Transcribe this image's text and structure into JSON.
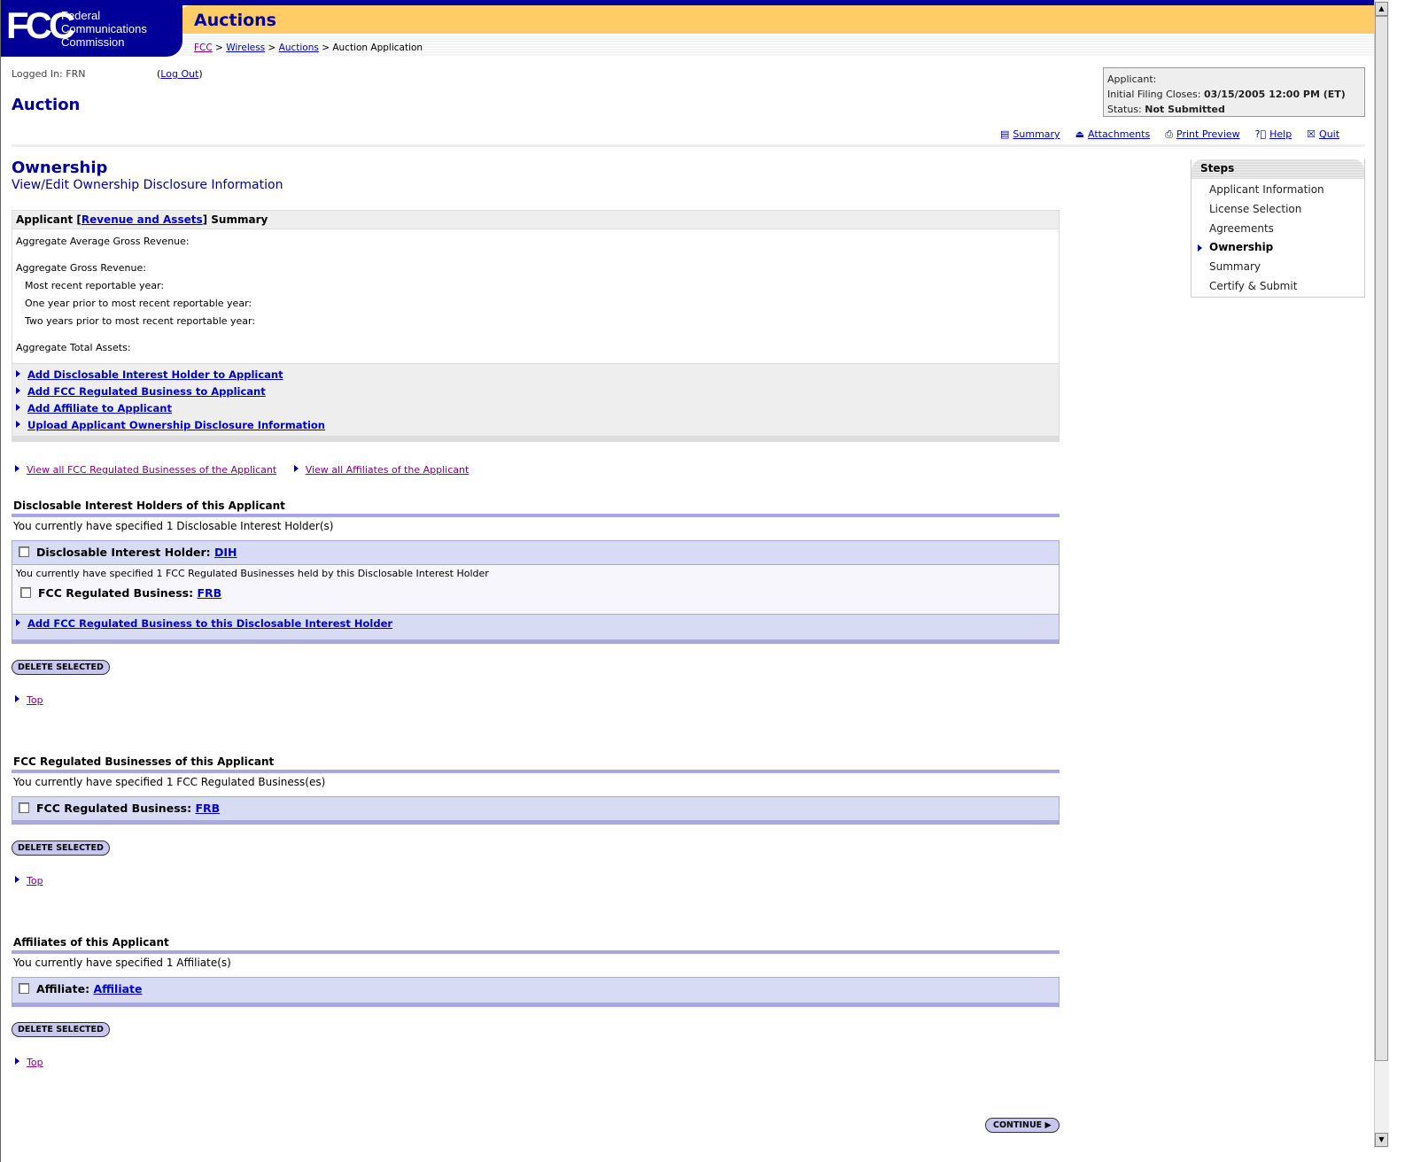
{
  "header": {
    "logo_mark": "FCC",
    "logo_text": [
      "Federal",
      "Communications",
      "Commission"
    ],
    "app_title": "Auctions",
    "breadcrumb": [
      {
        "label": "FCC"
      },
      {
        "label": "Wireless"
      },
      {
        "label": "Auctions"
      }
    ],
    "breadcrumb_current": "Auction Application",
    "separator": ">"
  },
  "session": {
    "logged_in": "Logged In: FRN",
    "logout_label": "Log Out"
  },
  "page_title": "Auction",
  "info": {
    "applicant_label": "Applicant:",
    "filing_label": "Initial Filing Closes:",
    "filing_value": "03/15/2005 12:00 PM (ET)",
    "status_label": "Status:",
    "status_value": "Not Submitted"
  },
  "toolbar": [
    {
      "label": "Summary",
      "icon": "summary-icon"
    },
    {
      "label": "Attachments",
      "icon": "upload-icon"
    },
    {
      "label": "Print Preview",
      "icon": "print-icon"
    },
    {
      "label": "Help",
      "icon": "help-icon"
    },
    {
      "label": "Quit",
      "icon": "close-icon"
    }
  ],
  "section": {
    "title": "Ownership",
    "subtitle": "View/Edit Ownership Disclosure Information"
  },
  "summary": {
    "hd_pre": "Applicant [",
    "hd_link": "Revenue and Assets",
    "hd_post": "] Summary",
    "lines": [
      "Aggregate Average Gross Revenue:",
      "Aggregate Gross Revenue:",
      "Most recent reportable year:",
      "One year prior to most recent reportable year:",
      "Two years prior to most recent reportable year:",
      "Aggregate Total Assets:"
    ],
    "links": [
      "Add Disclosable Interest Holder to Applicant",
      "Add FCC Regulated Business to Applicant",
      "Add Affiliate to Applicant",
      "Upload Applicant Ownership Disclosure Information"
    ]
  },
  "view_links": [
    "View all FCC Regulated Businesses of the Applicant",
    "View all Affiliates of the Applicant"
  ],
  "dih": {
    "title": "Disclosable Interest Holders of this Applicant",
    "count_text": "You currently have specified 1 Disclosable Interest Holder(s)",
    "row_label": "Disclosable Interest Holder:",
    "row_link": "DIH",
    "inner_text": "You currently have specified 1 FCC Regulated Businesses held by this Disclosable Interest Holder",
    "inner_label": "FCC Regulated Business:",
    "inner_link": "FRB",
    "add_link": "Add FCC Regulated Business to this Disclosable Interest Holder"
  },
  "frb": {
    "title": "FCC Regulated Businesses of this Applicant",
    "count_text": "You currently have specified 1 FCC Regulated Business(es)",
    "row_label": "FCC Regulated Business:",
    "row_link": "FRB"
  },
  "aff": {
    "title": "Affiliates of this Applicant",
    "count_text": "You currently have specified 1 Affiliate(s)",
    "row_label": "Affiliate:",
    "row_link": "Affiliate"
  },
  "buttons": {
    "delete": "DELETE SELECTED",
    "continue": "CONTINUE",
    "top": "Top"
  },
  "steps": {
    "title": "Steps",
    "items": [
      "Applicant Information",
      "License Selection",
      "Agreements",
      "Ownership",
      "Summary",
      "Certify & Submit"
    ],
    "current": "Ownership"
  },
  "colors": {
    "brand_blue": "#000099",
    "header_yellow": "#ffcc66",
    "row_bg": "#d8dbf4"
  }
}
